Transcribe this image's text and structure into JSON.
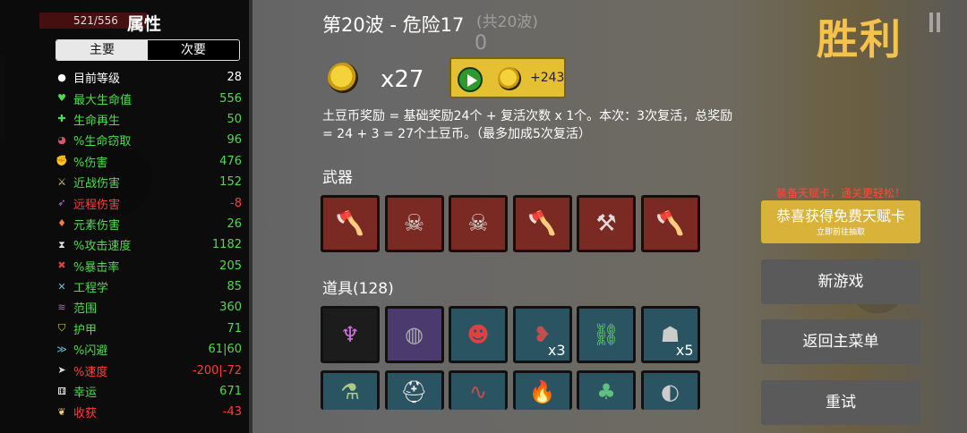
{
  "hud": {
    "hp": "521/556"
  },
  "stats_panel": {
    "title": "属性",
    "tabs": [
      "主要",
      "次要"
    ],
    "stats": [
      {
        "icon": "level-icon",
        "glyph": "●",
        "color": "#ffffff",
        "name_color": "#ffffff",
        "value_color": "#ffffff",
        "name": "目前等级",
        "value": "28"
      },
      {
        "icon": "heart-icon",
        "glyph": "♥",
        "color": "#4cdc4c",
        "name_color": "#4cdc4c",
        "value_color": "#4cdc4c",
        "name": "最大生命值",
        "value": "556"
      },
      {
        "icon": "regen-icon",
        "glyph": "✚",
        "color": "#4cdc4c",
        "name_color": "#4cdc4c",
        "value_color": "#4cdc4c",
        "name": "生命再生",
        "value": "50"
      },
      {
        "icon": "lifesteal-icon",
        "glyph": "◕",
        "color": "#e0506a",
        "name_color": "#4cdc4c",
        "value_color": "#4cdc4c",
        "name": "%生命窃取",
        "value": "96"
      },
      {
        "icon": "damage-icon",
        "glyph": "✊",
        "color": "#e05050",
        "name_color": "#4cdc4c",
        "value_color": "#4cdc4c",
        "name": "%伤害",
        "value": "476"
      },
      {
        "icon": "melee-icon",
        "glyph": "⚔",
        "color": "#f0d070",
        "name_color": "#4cdc4c",
        "value_color": "#4cdc4c",
        "name": "近战伤害",
        "value": "152"
      },
      {
        "icon": "ranged-icon",
        "glyph": "➶",
        "color": "#c070e0",
        "name_color": "#ff3b3b",
        "value_color": "#ff3b3b",
        "name": "远程伤害",
        "value": "-8"
      },
      {
        "icon": "elemental-icon",
        "glyph": "♦",
        "color": "#f08040",
        "name_color": "#4cdc4c",
        "value_color": "#4cdc4c",
        "name": "元素伤害",
        "value": "26"
      },
      {
        "icon": "attack-speed-icon",
        "glyph": "⧗",
        "color": "#dddddd",
        "name_color": "#4cdc4c",
        "value_color": "#4cdc4c",
        "name": "%攻击速度",
        "value": "1182"
      },
      {
        "icon": "crit-icon",
        "glyph": "✖",
        "color": "#e04040",
        "name_color": "#4cdc4c",
        "value_color": "#4cdc4c",
        "name": "%暴击率",
        "value": "205"
      },
      {
        "icon": "engineering-icon",
        "glyph": "✕",
        "color": "#70c0e0",
        "name_color": "#4cdc4c",
        "value_color": "#4cdc4c",
        "name": "工程学",
        "value": "85"
      },
      {
        "icon": "range-icon",
        "glyph": "≋",
        "color": "#b060e0",
        "name_color": "#4cdc4c",
        "value_color": "#4cdc4c",
        "name": "范围",
        "value": "360"
      },
      {
        "icon": "armor-icon",
        "glyph": "⛉",
        "color": "#f0d040",
        "name_color": "#4cdc4c",
        "value_color": "#4cdc4c",
        "name": "护甲",
        "value": "71"
      },
      {
        "icon": "dodge-icon",
        "glyph": "≫",
        "color": "#70c0e0",
        "name_color": "#4cdc4c",
        "value_color": "#4cdc4c",
        "name": "%闪避",
        "value": "61|60"
      },
      {
        "icon": "speed-icon",
        "glyph": "➤",
        "color": "#dddddd",
        "name_color": "#ff3b3b",
        "value_color": "#ff3b3b",
        "name": "%速度",
        "value": "-200|-72"
      },
      {
        "icon": "luck-icon",
        "glyph": "⚅",
        "color": "#ffffff",
        "name_color": "#4cdc4c",
        "value_color": "#4cdc4c",
        "name": "幸运",
        "value": "671"
      },
      {
        "icon": "harvest-icon",
        "glyph": "❦",
        "color": "#f0d070",
        "name_color": "#ff3b3b",
        "value_color": "#ff3b3b",
        "name": "收获",
        "value": "-43"
      }
    ]
  },
  "wave": {
    "title": "第20波 - 危险17",
    "total_ghost": "(共20波)",
    "counter_ghost": "0"
  },
  "reward": {
    "coin_count": "x27",
    "bonus_amount": "+243",
    "description": "土豆币奖励 = 基础奖励24个 + 复活次数 x 1个。本次：3次复活，总奖励 = 24 + 3 = 27个土豆币。（最多加成5次复活）"
  },
  "weapons": {
    "heading": "武器",
    "slots": [
      {
        "icon": "battle-axe-icon",
        "glyph": "🪓"
      },
      {
        "icon": "skull-axe-icon",
        "glyph": "☠"
      },
      {
        "icon": "skull-axe-icon",
        "glyph": "☠"
      },
      {
        "icon": "battle-axe-icon",
        "glyph": "🪓"
      },
      {
        "icon": "scythe-icon",
        "glyph": "⚒"
      },
      {
        "icon": "axe-icon",
        "glyph": "🪓"
      }
    ]
  },
  "items": {
    "heading": "道具(128)",
    "slots": [
      {
        "icon": "demon-altar-icon",
        "glyph": "♆",
        "tier": "c-dark",
        "color": "#d070e0",
        "count": ""
      },
      {
        "icon": "cracked-orb-icon",
        "glyph": "◍",
        "tier": "c-purple",
        "color": "#aaaaaa",
        "count": ""
      },
      {
        "icon": "clown-face-icon",
        "glyph": "☻",
        "tier": "c-teal",
        "color": "#e04040",
        "count": ""
      },
      {
        "icon": "meat-chunk-icon",
        "glyph": "❥",
        "tier": "c-teal",
        "color": "#c05050",
        "count": "x3"
      },
      {
        "icon": "chain-bundle-icon",
        "glyph": "⛓",
        "tier": "c-teal",
        "color": "#60d060",
        "count": ""
      },
      {
        "icon": "gas-mask-icon",
        "glyph": "☗",
        "tier": "c-teal",
        "color": "#cccccc",
        "count": "x5"
      },
      {
        "icon": "potion-sack-icon",
        "glyph": "⚗",
        "tier": "c-teal",
        "color": "#aacc88",
        "count": ""
      },
      {
        "icon": "helmet-icon",
        "glyph": "⛑",
        "tier": "c-teal",
        "color": "#eeeeee",
        "count": ""
      },
      {
        "icon": "worm-icon",
        "glyph": "∿",
        "tier": "c-teal",
        "color": "#c05050",
        "count": ""
      },
      {
        "icon": "fire-icon",
        "glyph": "🔥",
        "tier": "c-teal",
        "color": "#f0a030",
        "count": ""
      },
      {
        "icon": "plant-pot-icon",
        "glyph": "♣",
        "tier": "c-teal",
        "color": "#60c080",
        "count": ""
      },
      {
        "icon": "mirror-icon",
        "glyph": "◐",
        "tier": "c-teal",
        "color": "#cccccc",
        "count": ""
      }
    ]
  },
  "sidebar_right": {
    "victory": "胜利",
    "promo_line": "装备天赋卡，通关更轻松！",
    "promo_title": "恭喜获得免费天赋卡",
    "promo_sub": "立即前往抽取",
    "new_game": "新游戏",
    "main_menu": "返回主菜单",
    "retry": "重试"
  }
}
